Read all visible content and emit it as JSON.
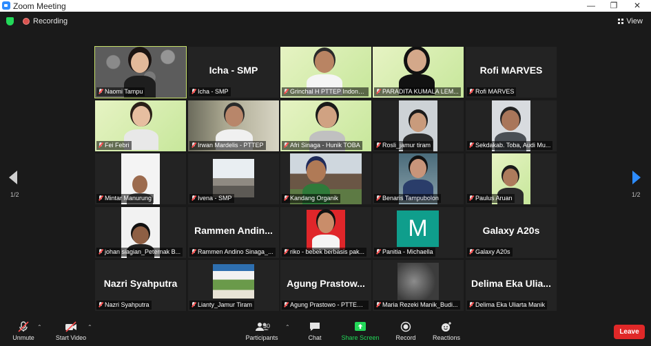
{
  "window": {
    "title": "Zoom Meeting",
    "minimize": "—",
    "restore": "❐",
    "close": "✕"
  },
  "topbar": {
    "recording_label": "Recording",
    "view_label": "View"
  },
  "pagination": {
    "left": "1/2",
    "right": "1/2"
  },
  "tiles": [
    {
      "label": "Naomi Tampu",
      "big": "",
      "kind": "video",
      "active": true
    },
    {
      "label": "Icha - SMP",
      "big": "Icha - SMP",
      "kind": "name"
    },
    {
      "label": "Grinchal H PTTEP Indone...",
      "big": "",
      "kind": "video"
    },
    {
      "label": "PARADITA KUMALA LEM...",
      "big": "",
      "kind": "video"
    },
    {
      "label": "Rofi MARVES",
      "big": "Rofi MARVES",
      "kind": "name"
    },
    {
      "label": "Fei Febri",
      "big": "",
      "kind": "video"
    },
    {
      "label": "Irwan Mardelis - PTTEP",
      "big": "",
      "kind": "video"
    },
    {
      "label": "Afri Sinaga - Hunik TOBA",
      "big": "",
      "kind": "video"
    },
    {
      "label": "Rosli_jamur tiram",
      "big": "",
      "kind": "video"
    },
    {
      "label": "Sekdakab. Toba, Audi Mu...",
      "big": "",
      "kind": "video"
    },
    {
      "label": "Mintar Manurung",
      "big": "",
      "kind": "video"
    },
    {
      "label": "Ivena - SMP",
      "big": "",
      "kind": "video"
    },
    {
      "label": "Kandang Organik",
      "big": "",
      "kind": "video"
    },
    {
      "label": "Benaris Tampubolon",
      "big": "",
      "kind": "video"
    },
    {
      "label": "Paulus Aruan",
      "big": "",
      "kind": "video"
    },
    {
      "label": "johan siagian_Peternak B...",
      "big": "",
      "kind": "video"
    },
    {
      "label": "Rammen Andino Sinaga_...",
      "big": "Rammen Andin...",
      "kind": "name"
    },
    {
      "label": "riko - bebek berbasis pak...",
      "big": "",
      "kind": "video"
    },
    {
      "label": "Panitia - Michaella",
      "big": "M",
      "kind": "avatar"
    },
    {
      "label": "Galaxy A20s",
      "big": "Galaxy A20s",
      "kind": "name"
    },
    {
      "label": "Nazri Syahputra",
      "big": "Nazri Syahputra",
      "kind": "name"
    },
    {
      "label": "Lianty_Jamur Tiram",
      "big": "",
      "kind": "video"
    },
    {
      "label": "Agung Prastowo - PTTEP ...",
      "big": "Agung Prastow...",
      "kind": "name"
    },
    {
      "label": "Maria Rezeki Manik_Budi...",
      "big": "",
      "kind": "video"
    },
    {
      "label": "Delima Eka Uliarta Manik",
      "big": "Delima Eka Ulia...",
      "kind": "name"
    }
  ],
  "toolbar": {
    "unmute": "Unmute",
    "start_video": "Start Video",
    "participants": "Participants",
    "participants_count": "30",
    "chat": "Chat",
    "share_screen": "Share Screen",
    "record": "Record",
    "reactions": "Reactions",
    "leave": "Leave"
  },
  "colors": {
    "share_green": "#23d959",
    "active_outline": "#c8e26a",
    "leave_red": "#e02828",
    "arrow_blue": "#2d8cff"
  }
}
